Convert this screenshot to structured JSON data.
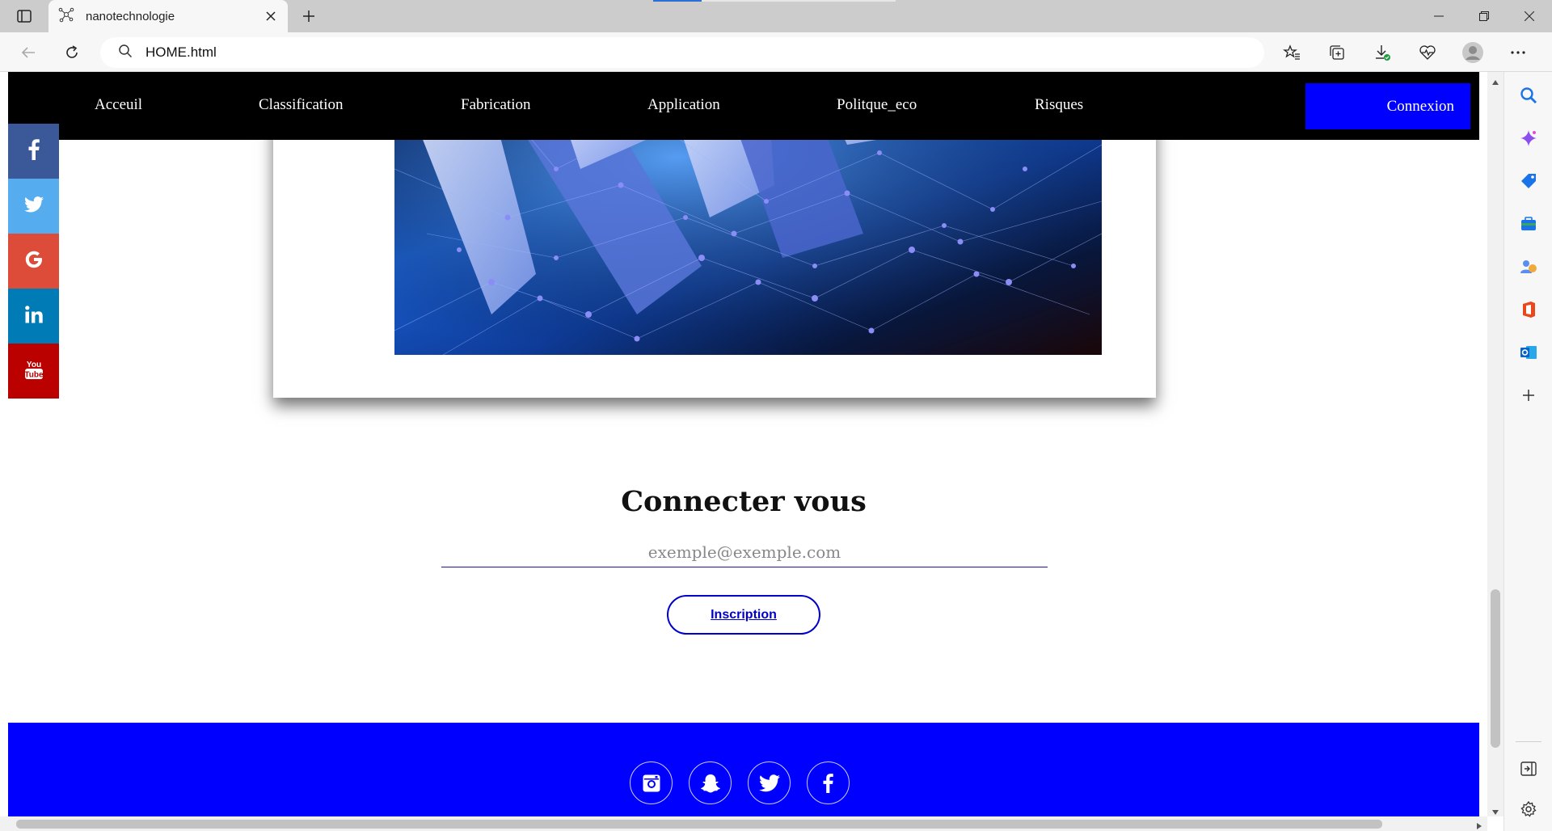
{
  "browser": {
    "tab_title": "nanotechnologie",
    "url": "HOME.html"
  },
  "nav": {
    "links": [
      "Acceuil",
      "Classification",
      "Fabrication",
      "Application",
      "Politque_eco",
      "Risques"
    ],
    "connexion_label": "Connexion"
  },
  "social": [
    "facebook-icon",
    "twitter-icon",
    "google-icon",
    "linkedin-icon",
    "youtube-icon"
  ],
  "signup": {
    "title": "Connecter vous",
    "email_placeholder": "exemple@exemple.com",
    "button_label": "Inscription"
  },
  "footer": {
    "icons": [
      "instagram-icon",
      "snapchat-icon",
      "twitter-icon",
      "facebook-icon"
    ]
  },
  "colors": {
    "nav_bg": "#000000",
    "accent_blue": "#0000ff",
    "facebook": "#3b5998",
    "twitter": "#55acee",
    "google": "#dd4b39",
    "linkedin": "#007bb5",
    "youtube": "#bb0000"
  }
}
